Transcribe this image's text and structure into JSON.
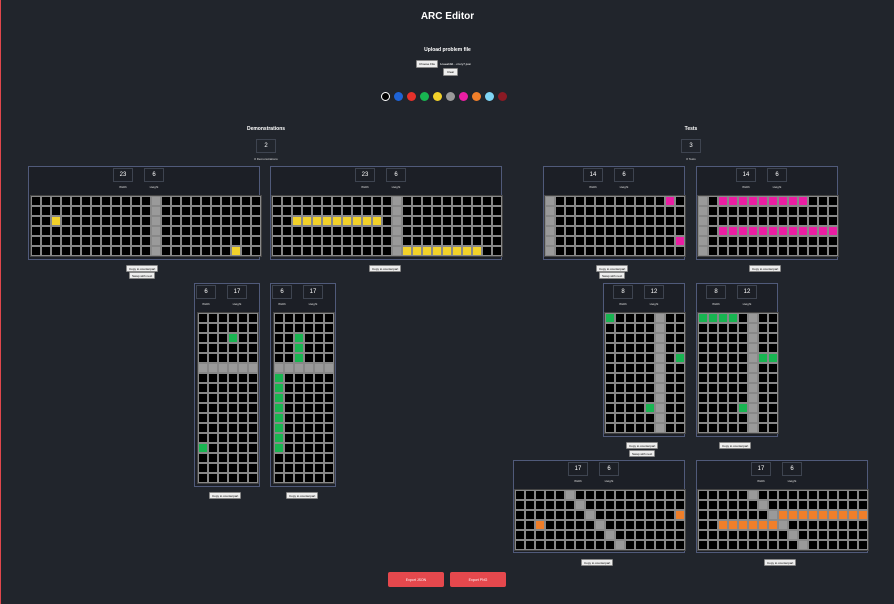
{
  "header": {
    "title": "ARC Editor",
    "upload_title": "Upload problem file"
  },
  "file": {
    "choose_label": "Choose File",
    "file_name": "1caeab9d....ntory7.json",
    "clear_label": "Clear"
  },
  "palette": [
    "#000000",
    "#1e63d6",
    "#e5312b",
    "#18b551",
    "#f2d12a",
    "#9a9a9a",
    "#ea1ea3",
    "#f07f2a",
    "#7fd5f5",
    "#8b1a24"
  ],
  "palette_labels": [
    "color-0",
    "color-1",
    "color-2",
    "color-3",
    "color-4",
    "color-5",
    "color-6",
    "color-7",
    "color-8",
    "color-9"
  ],
  "demonstrations": {
    "title": "Demonstrations",
    "count": "2",
    "count_label": "# Demonstrations"
  },
  "tests": {
    "title": "Tests",
    "count": "3",
    "count_label": "# Tests"
  },
  "labels": {
    "width": "Width",
    "height": "Height",
    "copy": "Copy to counterpart",
    "swap": "Swap with next"
  },
  "export": {
    "json": "Export JSON",
    "png": "Export PNG"
  },
  "colors": {
    "0": "#000000",
    "1": "#1e63d6",
    "2": "#e5312b",
    "3": "#18b551",
    "4": "#f2d12a",
    "5": "#9a9a9a",
    "6": "#ea1ea3",
    "7": "#f07f2a",
    "8": "#7fd5f5",
    "9": "#8b1a24"
  },
  "grids": [
    {
      "id": "demo1-input",
      "width": "23",
      "height": "6",
      "cells": [
        "00000000000050000000000",
        "00000000000050000000000",
        "00400000000050000000000",
        "00000000000050000000000",
        "00000000000050000000000",
        "00000000000050000000400"
      ]
    },
    {
      "id": "demo1-output",
      "width": "23",
      "height": "6",
      "cells": [
        "00000000000050000000000",
        "00000000000050000000000",
        "00444444444050000000000",
        "00000000000050000000000",
        "00000000000050000000000",
        "00000000000054444444400"
      ]
    },
    {
      "id": "test1-input",
      "width": "14",
      "height": "6",
      "cells": [
        "50000000000060",
        "50000000000000",
        "50000000000000",
        "50000000000000",
        "50000000000006",
        "50000000000000"
      ]
    },
    {
      "id": "test1-output",
      "width": "14",
      "height": "6",
      "cells": [
        "50666666666000",
        "50000000000000",
        "50000000000000",
        "50666666666666",
        "50000000000000",
        "50000000000000"
      ]
    },
    {
      "id": "demo2-input",
      "width": "6",
      "height": "17",
      "cells": [
        "000000",
        "000000",
        "000300",
        "000000",
        "000000",
        "555555",
        "000000",
        "000000",
        "000000",
        "000000",
        "000000",
        "000000",
        "000000",
        "300000",
        "000000",
        "000000",
        "000000"
      ]
    },
    {
      "id": "demo2-output",
      "width": "6",
      "height": "17",
      "cells": [
        "000000",
        "000000",
        "003000",
        "003000",
        "003000",
        "555555",
        "300000",
        "300000",
        "300000",
        "300000",
        "300000",
        "300000",
        "300000",
        "300000",
        "000000",
        "000000",
        "000000"
      ]
    },
    {
      "id": "test2-input",
      "width": "8",
      "height": "12",
      "cells": [
        "30000500",
        "00000500",
        "00000500",
        "00000500",
        "00000503",
        "00000500",
        "00000500",
        "00000500",
        "00000500",
        "00003500",
        "00000500",
        "00000500"
      ]
    },
    {
      "id": "test2-output",
      "width": "8",
      "height": "12",
      "cells": [
        "33330500",
        "00000500",
        "00000500",
        "00000500",
        "00000533",
        "00000500",
        "00000500",
        "00000500",
        "00000500",
        "00003500",
        "00000500",
        "00000500"
      ]
    },
    {
      "id": "test3-input",
      "width": "17",
      "height": "6",
      "cells": [
        "00000500000000000",
        "00000050000000000",
        "00000005000000007",
        "00700000500000000",
        "00000000050000000",
        "00000000005000000"
      ]
    },
    {
      "id": "test3-output",
      "width": "17",
      "height": "6",
      "cells": [
        "00000500000000000",
        "00000050000000000",
        "00000005777777777",
        "00777777500000000",
        "00000000050000000",
        "00000000005000000"
      ]
    }
  ]
}
